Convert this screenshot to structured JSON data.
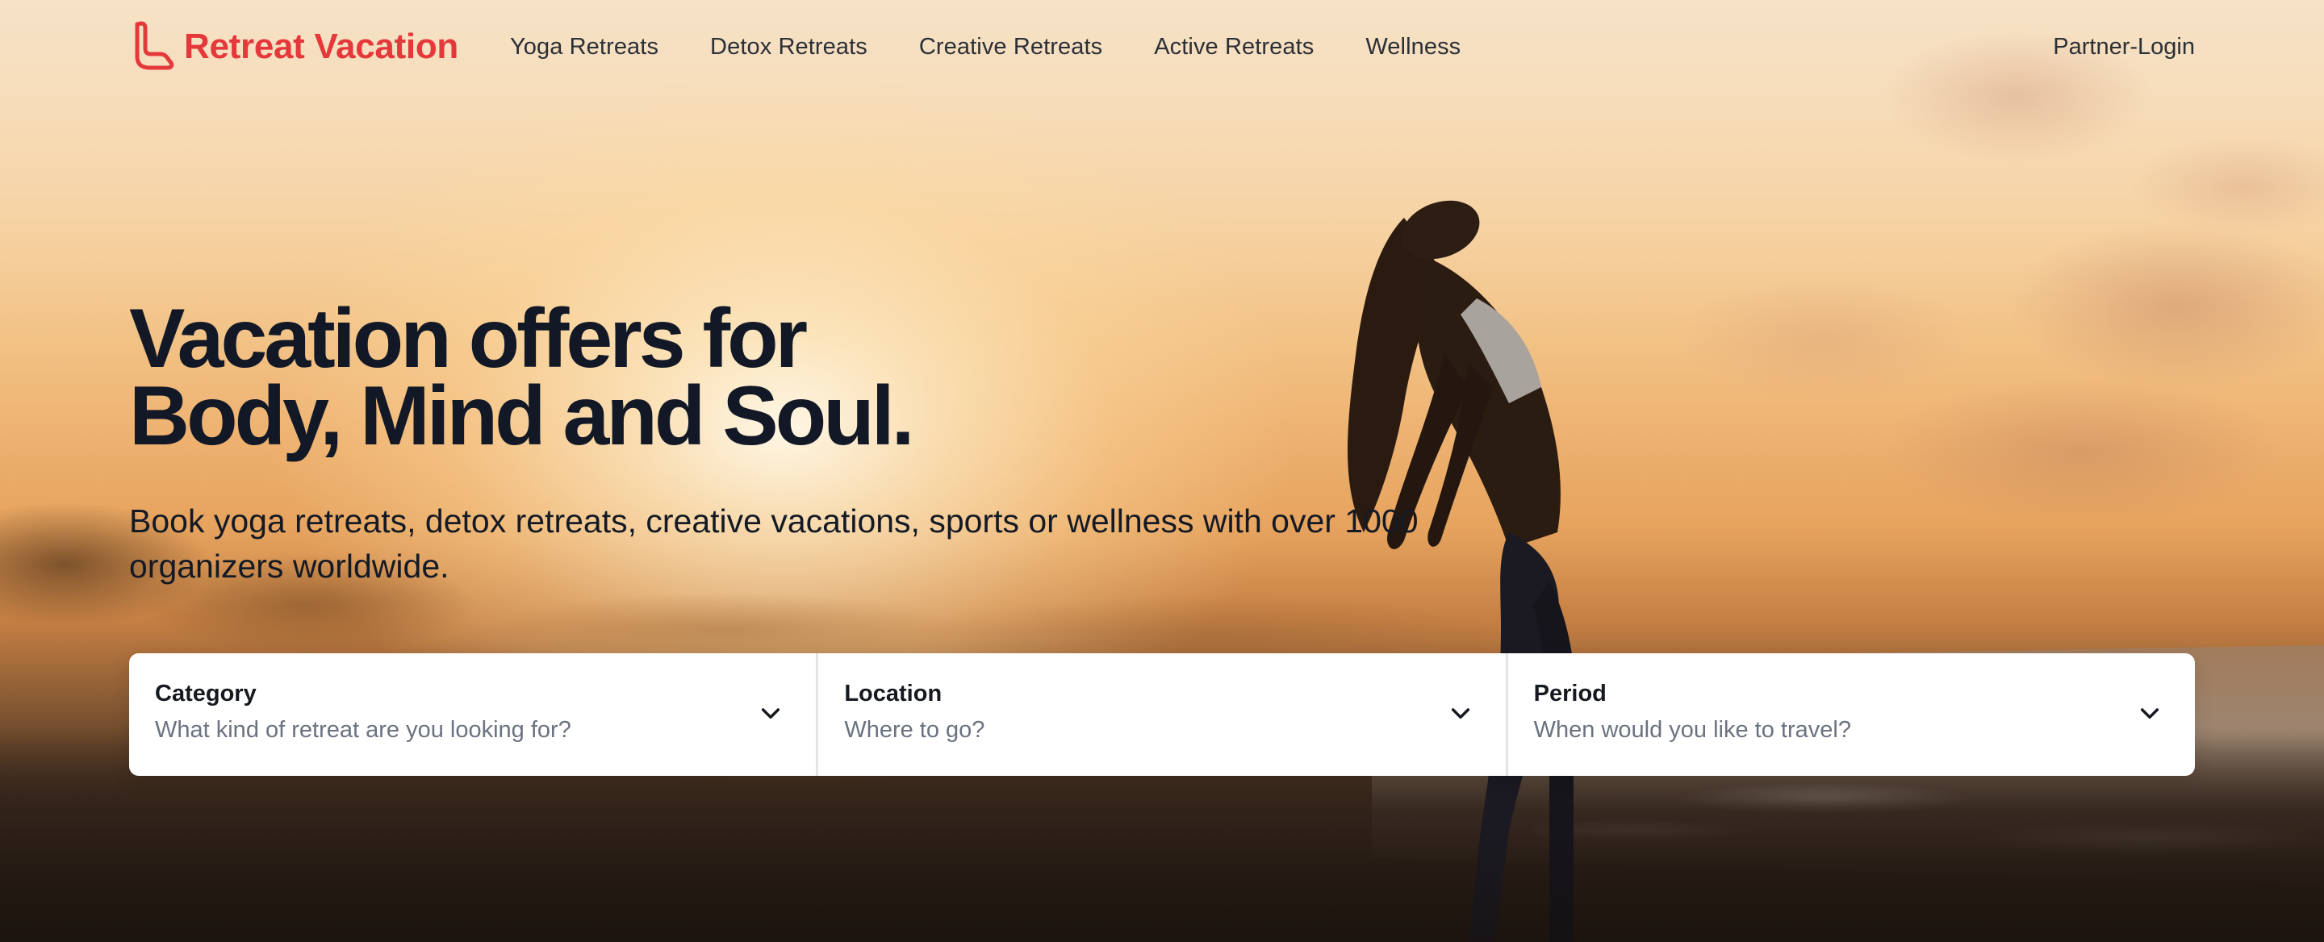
{
  "brand": {
    "name": "Retreat Vacation",
    "color": "#e5383b"
  },
  "nav": {
    "items": [
      {
        "label": "Yoga Retreats"
      },
      {
        "label": "Detox Retreats"
      },
      {
        "label": "Creative Retreats"
      },
      {
        "label": "Active Retreats"
      },
      {
        "label": "Wellness"
      }
    ],
    "partner_login": "Partner-Login"
  },
  "hero": {
    "headline_line1": "Vacation offers for",
    "headline_line2": "Body, Mind and Soul.",
    "subline": "Book yoga retreats, detox retreats, creative vacations, sports or wellness with over 1000 organizers worldwide.",
    "background_image": "sunset-beach-yoga-silhouette"
  },
  "search": {
    "fields": [
      {
        "label": "Category",
        "placeholder": "What kind of retreat are you looking for?",
        "icon": "chevron-down-icon"
      },
      {
        "label": "Location",
        "placeholder": "Where to go?",
        "icon": "chevron-down-icon"
      },
      {
        "label": "Period",
        "placeholder": "When would you like to travel?",
        "icon": "chevron-down-icon"
      }
    ]
  }
}
